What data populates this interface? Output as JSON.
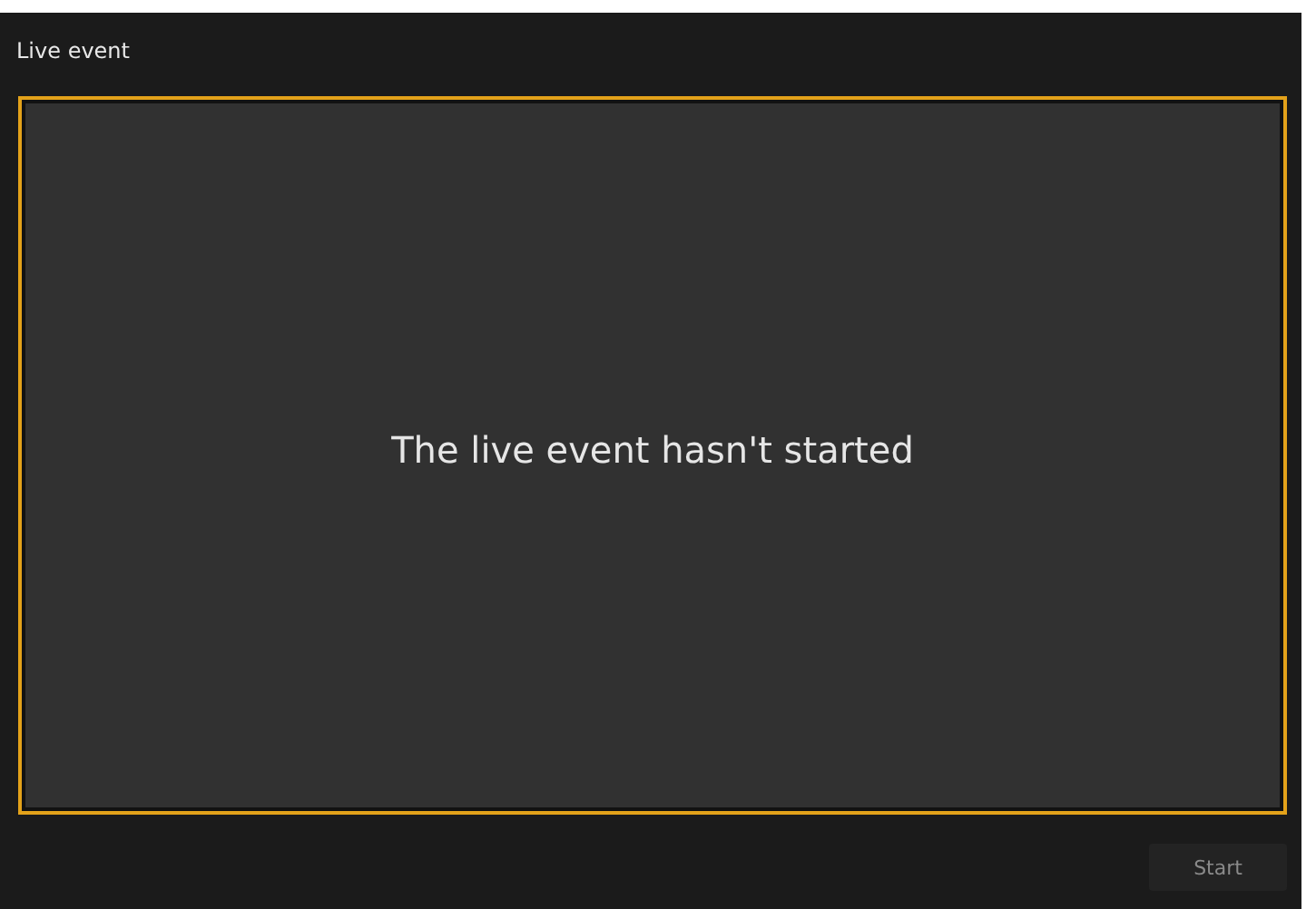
{
  "window": {
    "title": "Live event"
  },
  "stage": {
    "message": "The live event hasn't started"
  },
  "start_button": {
    "label": "Start",
    "disabled": true
  }
}
